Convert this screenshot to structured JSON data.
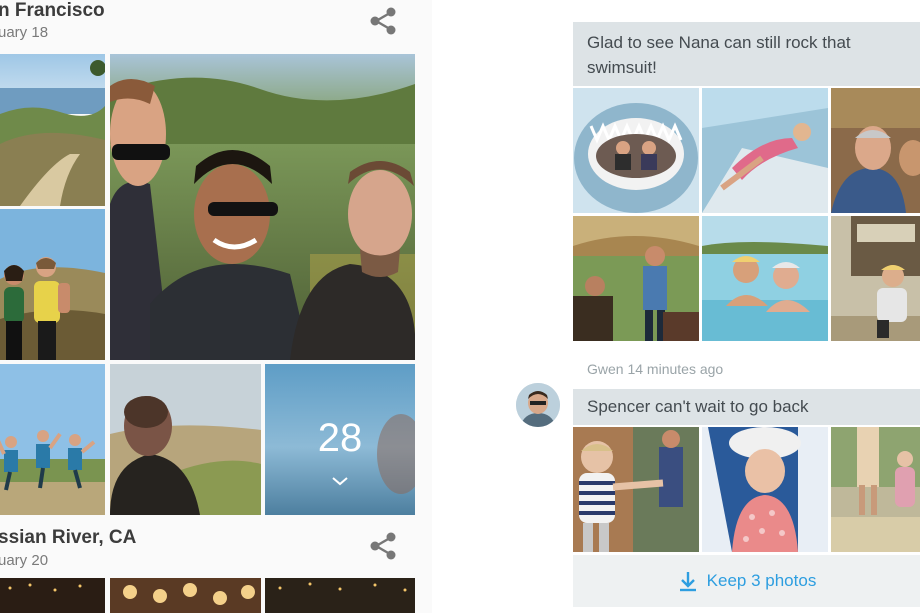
{
  "albums": [
    {
      "title": "n Francisco",
      "date": "uary 18",
      "share_icon": "share-icon",
      "more_count": "28"
    },
    {
      "title": "ssian River, CA",
      "date": "uary 20",
      "share_icon": "share-icon"
    }
  ],
  "feed": {
    "post1": {
      "caption": "Glad to see Nana can still rock that swimsuit!"
    },
    "post2": {
      "author_time": "Gwen 14 minutes ago",
      "caption": "Spencer can't wait to go back",
      "keep_label": "Keep 3 photos",
      "keep_icon": "download-icon"
    }
  },
  "colors": {
    "accent": "#2d9ee0",
    "bubble_bg": "#dde3e6"
  }
}
